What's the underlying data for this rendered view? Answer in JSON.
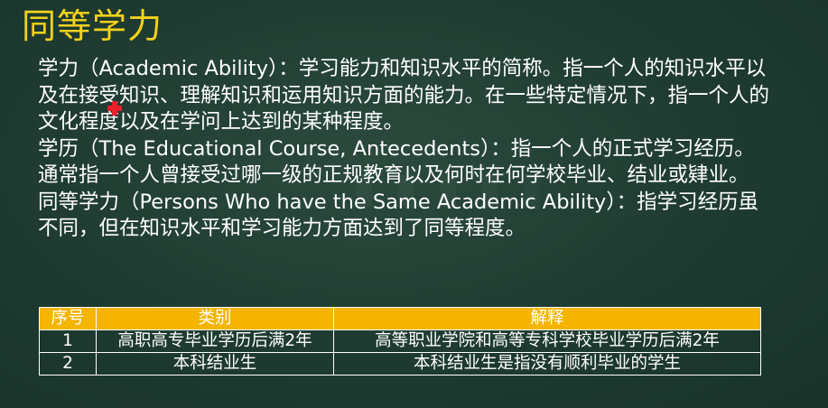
{
  "slide": {
    "title": "同等学力",
    "paragraphs": [
      "学力（Academic Ability）：学习能力和知识水平的简称。指一个人的知识水平以及在接受知识、理解知识和运用知识方面的能力。在一些特定情况下，指一个人的文化程度以及在学问上达到的某种程度。",
      "学历（The Educational Course, Antecedents）：指一个人的正式学习经历。通常指一个人曾接受过哪一级的正规教育以及何时在何学校毕业、结业或肄业。",
      "同等学力（Persons Who have the Same Academic Ability）：指学习经历虽不同，但在知识水平和学习能力方面达到了同等程度。"
    ]
  },
  "table": {
    "headers": [
      "序号",
      "类别",
      "解释"
    ],
    "rows": [
      [
        "1",
        "高职高专毕业学历后满2年",
        "高等职业学院和高等专科学校毕业学历后满2年"
      ],
      [
        "2",
        "本科结业生",
        "本科结业生是指没有顺利毕业的学生"
      ]
    ]
  },
  "colors": {
    "title": "#f2d21c",
    "header_bg": "#f4b400",
    "text": "#ffffff",
    "background": "#1f3b31",
    "cursor": "#e8202a"
  },
  "icons": {
    "cursor": "red-plus-cursor-icon"
  }
}
